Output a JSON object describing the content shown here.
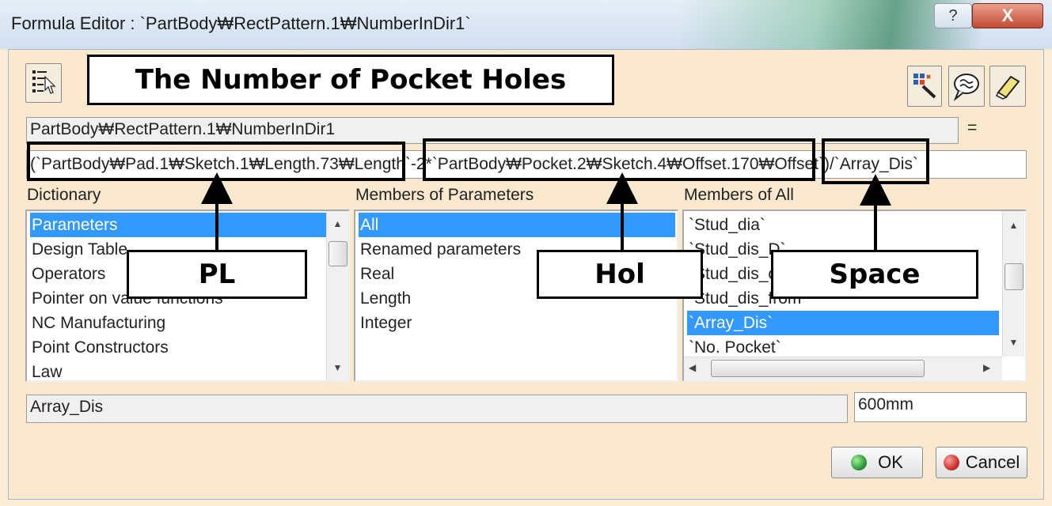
{
  "window": {
    "title": "Formula Editor : `PartBody₩RectPattern.1₩NumberInDir1`",
    "help_glyph": "?",
    "close_glyph": "X"
  },
  "parameter": {
    "name": "PartBody₩RectPattern.1₩NumberInDir1",
    "equals": "="
  },
  "formula": {
    "value": "(`PartBody₩Pad.1₩Sketch.1₩Length.73₩Length`-2*`PartBody₩Pocket.2₩Sketch.4₩Offset.170₩Offset`)/`Array_Dis`"
  },
  "dictionary": {
    "label": "Dictionary",
    "items": [
      "Parameters",
      "Design Table",
      "Operators",
      "Pointer on value functions",
      "NC Manufacturing",
      "Point Constructors",
      "Law"
    ],
    "selected": "Parameters"
  },
  "members_params": {
    "label": "Members of Parameters",
    "items": [
      "All",
      "Renamed parameters",
      "Real",
      "Length",
      "Integer"
    ],
    "selected": "All"
  },
  "members_all": {
    "label": "Members of All",
    "items": [
      "`Stud_dia`",
      "`Stud_dis_D`",
      "`Stud_dis_c",
      "`Stud_dis_from",
      "`Array_Dis`",
      "`No. Pocket`"
    ],
    "selected": "`Array_Dis`"
  },
  "selected_param": {
    "name": "Array_Dis",
    "value": "600mm"
  },
  "buttons": {
    "ok": "OK",
    "cancel": "Cancel"
  },
  "annotations": {
    "title": "The Number of Pocket Holes",
    "pl": "PL",
    "hol": "Hol",
    "space": "Space"
  },
  "colors": {
    "selection": "#3399ff",
    "ok_dot": "#2e9b3a",
    "cancel_dot": "#d0312d",
    "dialog_bg": "#fbe9cf"
  },
  "icons": [
    "formula-tree-icon",
    "add-parameter-icon",
    "comment-icon",
    "eraser-icon"
  ]
}
